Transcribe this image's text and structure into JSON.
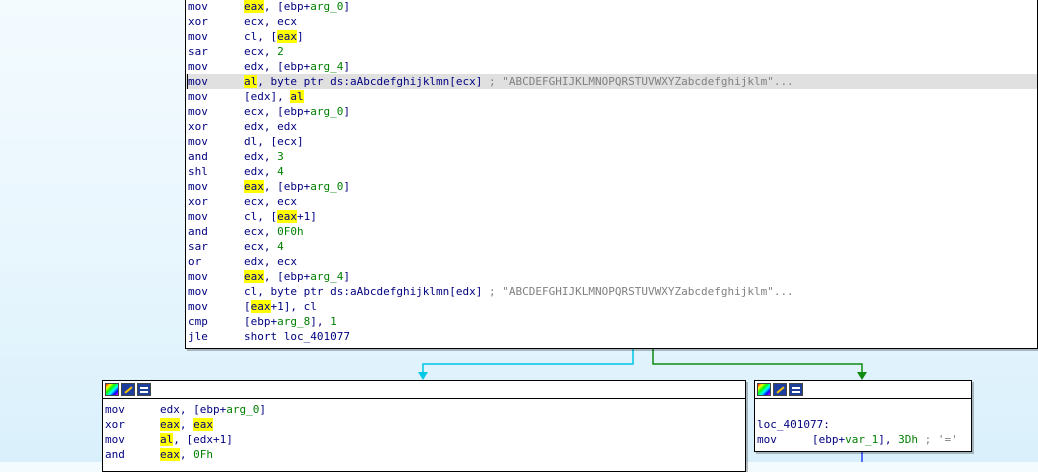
{
  "main_block": {
    "lines": [
      {
        "mnem": "mov",
        "ops": [
          {
            "t": "eax",
            "hl": true
          },
          {
            "t": ", [ebp+"
          },
          {
            "t": "arg_0",
            "c": "arg"
          },
          {
            "t": "]"
          }
        ]
      },
      {
        "mnem": "xor",
        "ops": [
          {
            "t": "ecx, ecx"
          }
        ]
      },
      {
        "mnem": "mov",
        "ops": [
          {
            "t": "cl, ["
          },
          {
            "t": "eax",
            "hl": true
          },
          {
            "t": "]"
          }
        ]
      },
      {
        "mnem": "sar",
        "ops": [
          {
            "t": "ecx, "
          },
          {
            "t": "2",
            "c": "num"
          }
        ]
      },
      {
        "mnem": "mov",
        "ops": [
          {
            "t": "edx, [ebp+"
          },
          {
            "t": "arg_4",
            "c": "arg"
          },
          {
            "t": "]"
          }
        ]
      },
      {
        "mnem": "mov",
        "sel": true,
        "caret": true,
        "ops": [
          {
            "t": "al",
            "hl": true
          },
          {
            "t": ", byte ptr ds:aAbcdefghijklmn[ecx] "
          },
          {
            "t": "; \"ABCDEFGHIJKLMNOPQRSTUVWXYZabcdefghijklm\"...",
            "c": "cmt"
          }
        ]
      },
      {
        "mnem": "mov",
        "ops": [
          {
            "t": "[edx], "
          },
          {
            "t": "al",
            "hl": true
          }
        ]
      },
      {
        "mnem": "mov",
        "ops": [
          {
            "t": "ecx, [ebp+"
          },
          {
            "t": "arg_0",
            "c": "arg"
          },
          {
            "t": "]"
          }
        ]
      },
      {
        "mnem": "xor",
        "ops": [
          {
            "t": "edx, edx"
          }
        ]
      },
      {
        "mnem": "mov",
        "ops": [
          {
            "t": "dl, [ecx]"
          }
        ]
      },
      {
        "mnem": "and",
        "ops": [
          {
            "t": "edx, "
          },
          {
            "t": "3",
            "c": "num"
          }
        ]
      },
      {
        "mnem": "shl",
        "ops": [
          {
            "t": "edx, "
          },
          {
            "t": "4",
            "c": "num"
          }
        ]
      },
      {
        "mnem": "mov",
        "ops": [
          {
            "t": "eax",
            "hl": true
          },
          {
            "t": ", [ebp+"
          },
          {
            "t": "arg_0",
            "c": "arg"
          },
          {
            "t": "]"
          }
        ]
      },
      {
        "mnem": "xor",
        "ops": [
          {
            "t": "ecx, ecx"
          }
        ]
      },
      {
        "mnem": "mov",
        "ops": [
          {
            "t": "cl, ["
          },
          {
            "t": "eax",
            "hl": true
          },
          {
            "t": "+1]"
          }
        ]
      },
      {
        "mnem": "and",
        "ops": [
          {
            "t": "ecx, "
          },
          {
            "t": "0F0h",
            "c": "num"
          }
        ]
      },
      {
        "mnem": "sar",
        "ops": [
          {
            "t": "ecx, "
          },
          {
            "t": "4",
            "c": "num"
          }
        ]
      },
      {
        "mnem": "or",
        "ops": [
          {
            "t": "edx, ecx"
          }
        ]
      },
      {
        "mnem": "mov",
        "ops": [
          {
            "t": "eax",
            "hl": true
          },
          {
            "t": ", [ebp+"
          },
          {
            "t": "arg_4",
            "c": "arg"
          },
          {
            "t": "]"
          }
        ]
      },
      {
        "mnem": "mov",
        "ops": [
          {
            "t": "cl, byte ptr ds:aAbcdefghijklmn[edx] "
          },
          {
            "t": "; \"ABCDEFGHIJKLMNOPQRSTUVWXYZabcdefghijklm\"...",
            "c": "cmt"
          }
        ]
      },
      {
        "mnem": "mov",
        "ops": [
          {
            "t": "["
          },
          {
            "t": "eax",
            "hl": true
          },
          {
            "t": "+1], cl"
          }
        ]
      },
      {
        "mnem": "cmp",
        "ops": [
          {
            "t": "[ebp+"
          },
          {
            "t": "arg_8",
            "c": "arg"
          },
          {
            "t": "], "
          },
          {
            "t": "1",
            "c": "num"
          }
        ]
      },
      {
        "mnem": "jle",
        "ops": [
          {
            "t": "short loc_401077"
          }
        ]
      }
    ]
  },
  "left_block": {
    "lines": [
      {
        "mnem": "mov",
        "ops": [
          {
            "t": "edx, [ebp+"
          },
          {
            "t": "arg_0",
            "c": "arg"
          },
          {
            "t": "]"
          }
        ]
      },
      {
        "mnem": "xor",
        "ops": [
          {
            "t": "eax",
            "hl": true
          },
          {
            "t": ", "
          },
          {
            "t": "eax",
            "hl": true
          }
        ]
      },
      {
        "mnem": "mov",
        "ops": [
          {
            "t": "al",
            "hl": true
          },
          {
            "t": ", [edx+1]"
          }
        ]
      },
      {
        "mnem": "and",
        "ops": [
          {
            "t": "eax",
            "hl": true
          },
          {
            "t": ", "
          },
          {
            "t": "0Fh",
            "c": "num"
          }
        ]
      }
    ]
  },
  "right_block": {
    "label": "loc_401077:",
    "lines": [
      {
        "mnem": "mov",
        "ops": [
          {
            "t": "[ebp+"
          },
          {
            "t": "var_1",
            "c": "arg"
          },
          {
            "t": "], "
          },
          {
            "t": "3Dh",
            "c": "num"
          },
          {
            "t": " ; '='",
            "c": "cmt"
          }
        ]
      }
    ]
  },
  "colors": {
    "highlight": "#ffff00",
    "edge_false": "#00c8e8",
    "edge_true": "#108a10",
    "edge_blue": "#2040ff"
  },
  "icons": [
    "graph-overview-icon",
    "edit-node-icon",
    "xref-list-icon"
  ]
}
